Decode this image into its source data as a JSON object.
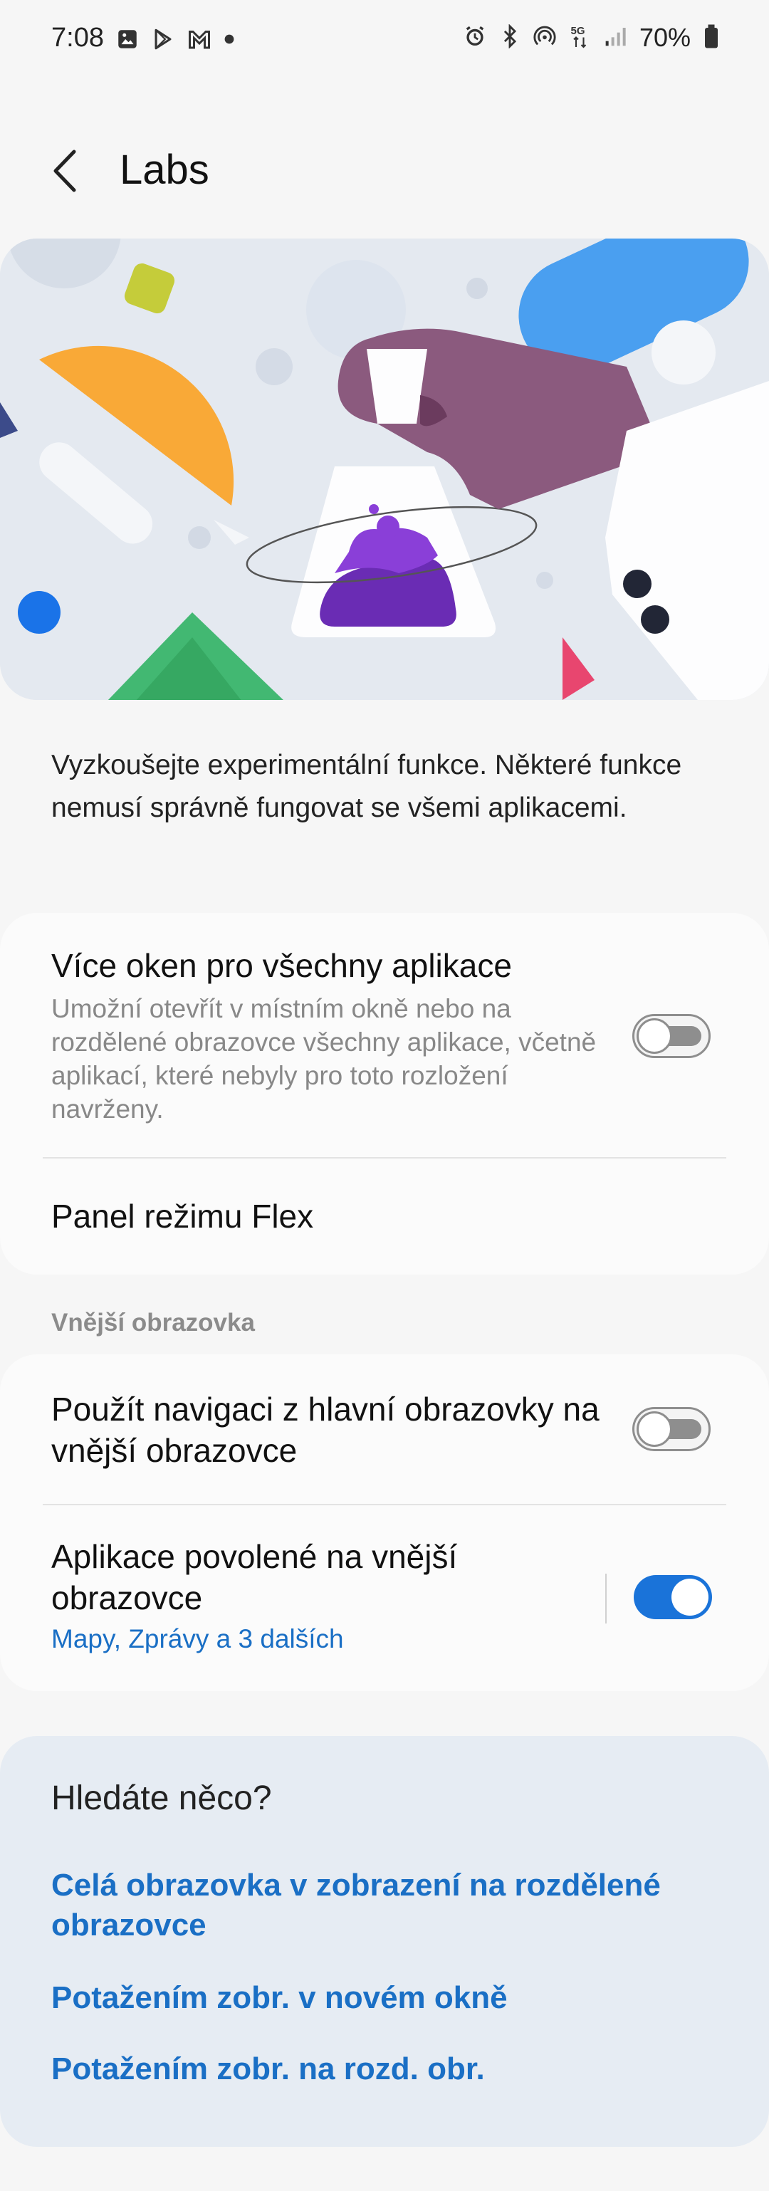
{
  "status_bar": {
    "time": "7:08",
    "battery": "70%",
    "network": "5G"
  },
  "header": {
    "title": "Labs"
  },
  "description": "Vyzkoušejte experimentální funkce. Některé funkce nemusí správně fungovat se všemi aplikacemi.",
  "card1": {
    "item1": {
      "title": "Více oken pro všechny aplikace",
      "subtitle": "Umožní otevřít v místním okně nebo na rozdělené obrazovce všechny aplikace, včetně aplikací, které nebyly pro toto rozložení navrženy.",
      "enabled": false
    },
    "item2": {
      "title": "Panel režimu Flex"
    }
  },
  "section_label": "Vnější obrazovka",
  "card2": {
    "item1": {
      "title": "Použít navigaci z hlavní obrazovky na vnější obrazovce",
      "enabled": false
    },
    "item2": {
      "title": "Aplikace povolené na vnější obrazovce",
      "link": "Mapy, Zprávy a 3 dalších",
      "enabled": true
    }
  },
  "lookfor": {
    "title": "Hledáte něco?",
    "links": [
      "Celá obrazovka v zobrazení na rozdělené obrazovce",
      "Potažením zobr. v novém okně",
      "Potažením zobr. na rozd. obr."
    ]
  },
  "colors": {
    "accent": "#1a73d9",
    "link": "#1a6fc5",
    "background": "#f6f6f6",
    "card": "#fbfbfb"
  }
}
